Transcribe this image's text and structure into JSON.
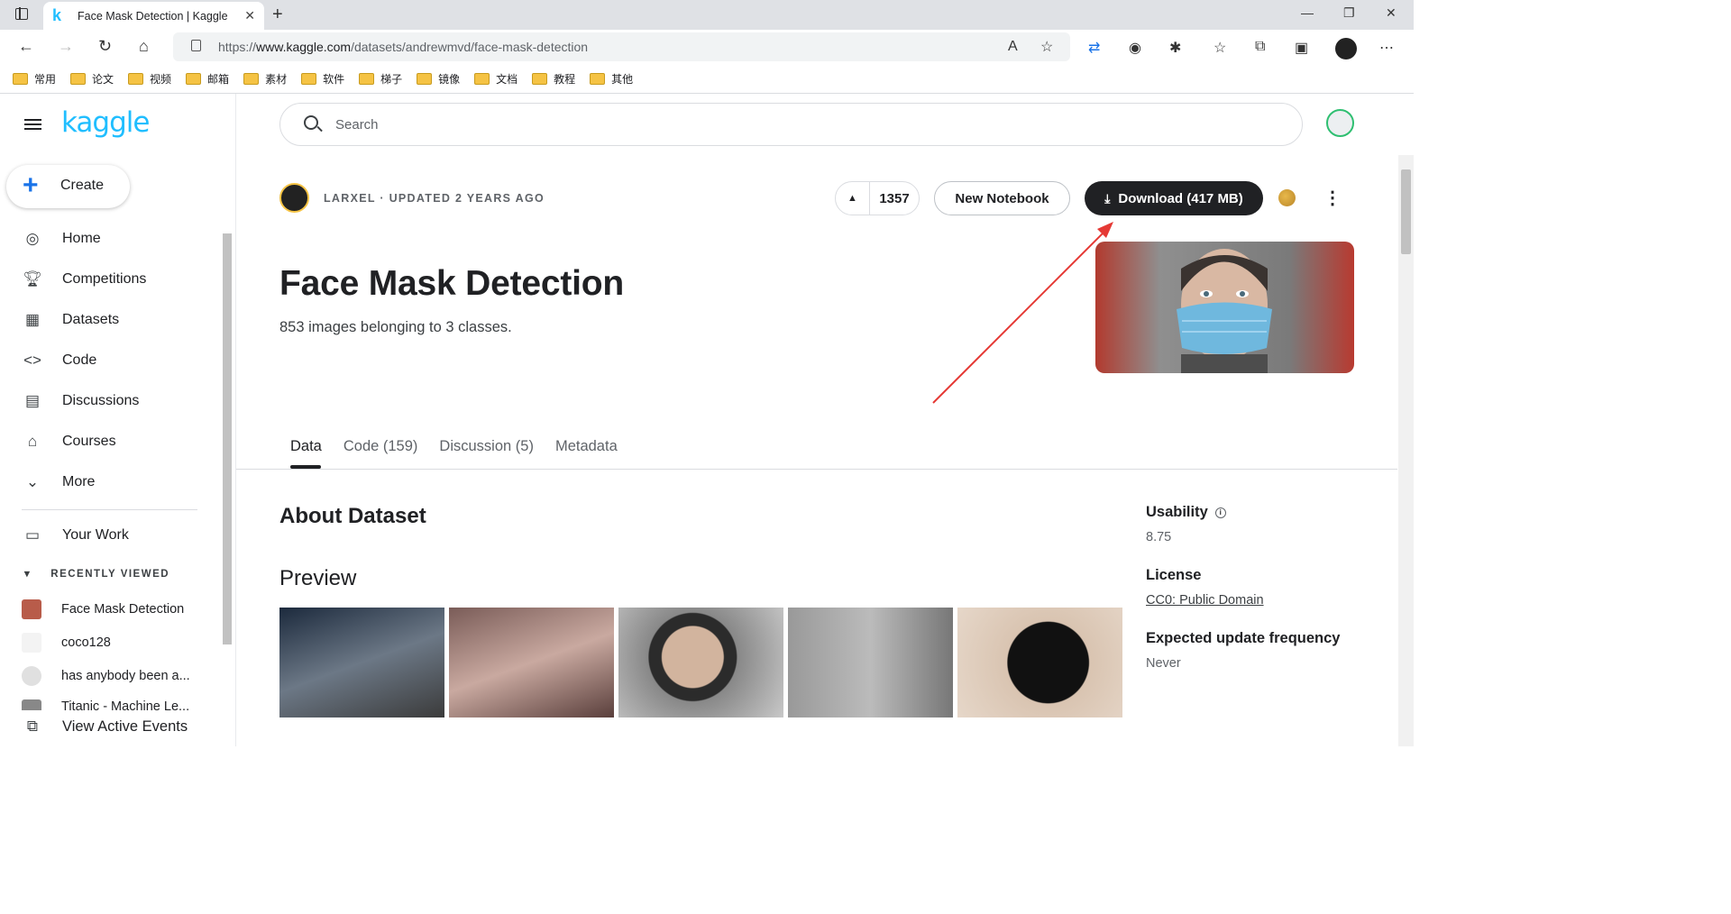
{
  "browser": {
    "tab_title": "Face Mask Detection | Kaggle",
    "url_prefix": "https://",
    "url_host": "www.kaggle.com",
    "url_path": "/datasets/andrewmvd/face-mask-detection"
  },
  "bookmarks": [
    "常用",
    "论文",
    "视频",
    "邮箱",
    "素材",
    "软件",
    "梯子",
    "镜像",
    "文档",
    "教程",
    "其他"
  ],
  "sidebar": {
    "logo": "kaggle",
    "create_label": "Create",
    "nav": [
      {
        "label": "Home",
        "icon": "compass-icon"
      },
      {
        "label": "Competitions",
        "icon": "trophy-icon"
      },
      {
        "label": "Datasets",
        "icon": "table-icon"
      },
      {
        "label": "Code",
        "icon": "code-icon"
      },
      {
        "label": "Discussions",
        "icon": "comments-icon"
      },
      {
        "label": "Courses",
        "icon": "school-icon"
      },
      {
        "label": "More",
        "icon": "chevron-down-icon"
      }
    ],
    "your_work": "Your Work",
    "recent_heading": "RECENTLY VIEWED",
    "recent": [
      "Face Mask Detection",
      "coco128",
      "has anybody been a...",
      "Titanic - Machine Le..."
    ],
    "view_events": "View Active Events"
  },
  "search": {
    "placeholder": "Search"
  },
  "dataset": {
    "author_meta": "LARXEL · UPDATED 2 YEARS AGO",
    "votes": "1357",
    "new_notebook": "New Notebook",
    "download": "Download (417 MB)",
    "title": "Face Mask Detection",
    "subtitle": "853 images belonging to 3 classes.",
    "tabs": [
      "Data",
      "Code (159)",
      "Discussion (5)",
      "Metadata"
    ],
    "about": "About Dataset",
    "preview": "Preview"
  },
  "meta": {
    "usability_label": "Usability",
    "usability_value": "8.75",
    "license_label": "License",
    "license_value": "CC0: Public Domain",
    "frequency_label": "Expected update frequency",
    "frequency_value": "Never"
  },
  "colors": {
    "kaggle_blue": "#20beff",
    "download_bg": "#202124",
    "annotation_arrow": "#e53935"
  }
}
